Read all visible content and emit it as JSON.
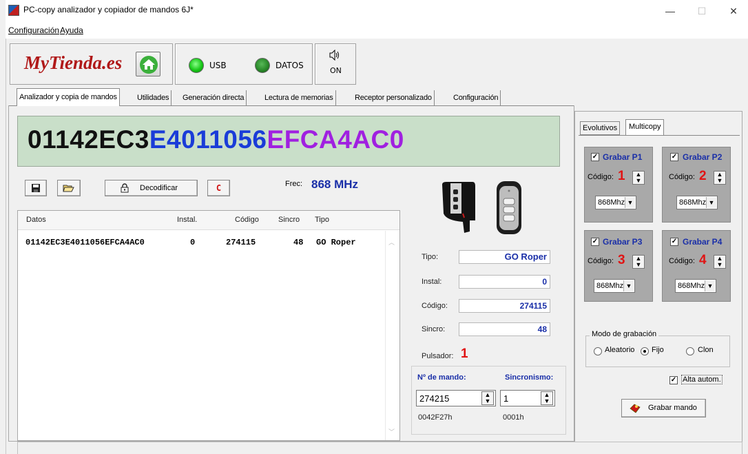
{
  "window": {
    "title": "PC-copy analizador y copiador de mandos 6J*",
    "min": "—",
    "max": "☐",
    "close": "✕"
  },
  "menu": {
    "config": "Configuración",
    "help": "Ayuda"
  },
  "header": {
    "logo": "MyTienda.es",
    "usb_label": "USB",
    "datos_label": "DATOS",
    "sound_label": "ON"
  },
  "tabs": [
    "Analizador y copia de mandos",
    "Utilidades",
    "Generación directa",
    "Lectura de memorias",
    "Receptor personalizado",
    "Configuración"
  ],
  "display": {
    "part1": "01142EC3",
    "part2": "E4011056",
    "part3": "EFCA4AC0"
  },
  "toolbar": {
    "decode_label": "Decodificar",
    "clear_label": "C",
    "freq_label": "Frec:",
    "freq_value": "868 MHz"
  },
  "table": {
    "headers": [
      "Datos",
      "Instal.",
      "Código",
      "Sincro",
      "Tipo"
    ],
    "rows": [
      {
        "datos": "01142EC3E4011056EFCA4AC0",
        "instal": "0",
        "codigo": "274115",
        "sincro": "48",
        "tipo": "GO Roper"
      }
    ]
  },
  "details": {
    "tipo_label": "Tipo:",
    "tipo_value": "GO Roper",
    "instal_label": "Instal:",
    "instal_value": "0",
    "codigo_label": "Código:",
    "codigo_value": "274115",
    "sincro_label": "Sincro:",
    "sincro_value": "48",
    "pulsador_label": "Pulsador:",
    "pulsador_value": "1"
  },
  "mando": {
    "num_label": "Nº de mando:",
    "sync_label": "Sincronismo:",
    "num_value": "274215",
    "sync_value": "1",
    "num_hex": "0042F27h",
    "sync_hex": "0001h"
  },
  "right_tabs": {
    "evolutivos": "Evolutivos",
    "multicopy": "Multicopy"
  },
  "grabar": [
    {
      "label": "Grabar P1",
      "code_label": "Código:",
      "code": "1",
      "freq": "868Mhz"
    },
    {
      "label": "Grabar P2",
      "code_label": "Código:",
      "code": "2",
      "freq": "868Mhz"
    },
    {
      "label": "Grabar P3",
      "code_label": "Código:",
      "code": "3",
      "freq": "868Mhz"
    },
    {
      "label": "Grabar P4",
      "code_label": "Código:",
      "code": "4",
      "freq": "868Mhz"
    }
  ],
  "modo": {
    "title": "Modo de grabación",
    "aleatorio": "Aleatorio",
    "fijo": "Fijo",
    "clon": "Clon",
    "selected": "Fijo"
  },
  "alta": {
    "label": "Alta autom.",
    "checked": true
  },
  "grabar_mando": {
    "label": "Grabar mando"
  },
  "colors": {
    "display_bg": "#c9dfc9",
    "code_black": "#111111",
    "code_blue": "#1a3cd8",
    "code_purple": "#a020e0",
    "accent_blue": "#1a2fa8",
    "accent_red": "#e01414"
  }
}
